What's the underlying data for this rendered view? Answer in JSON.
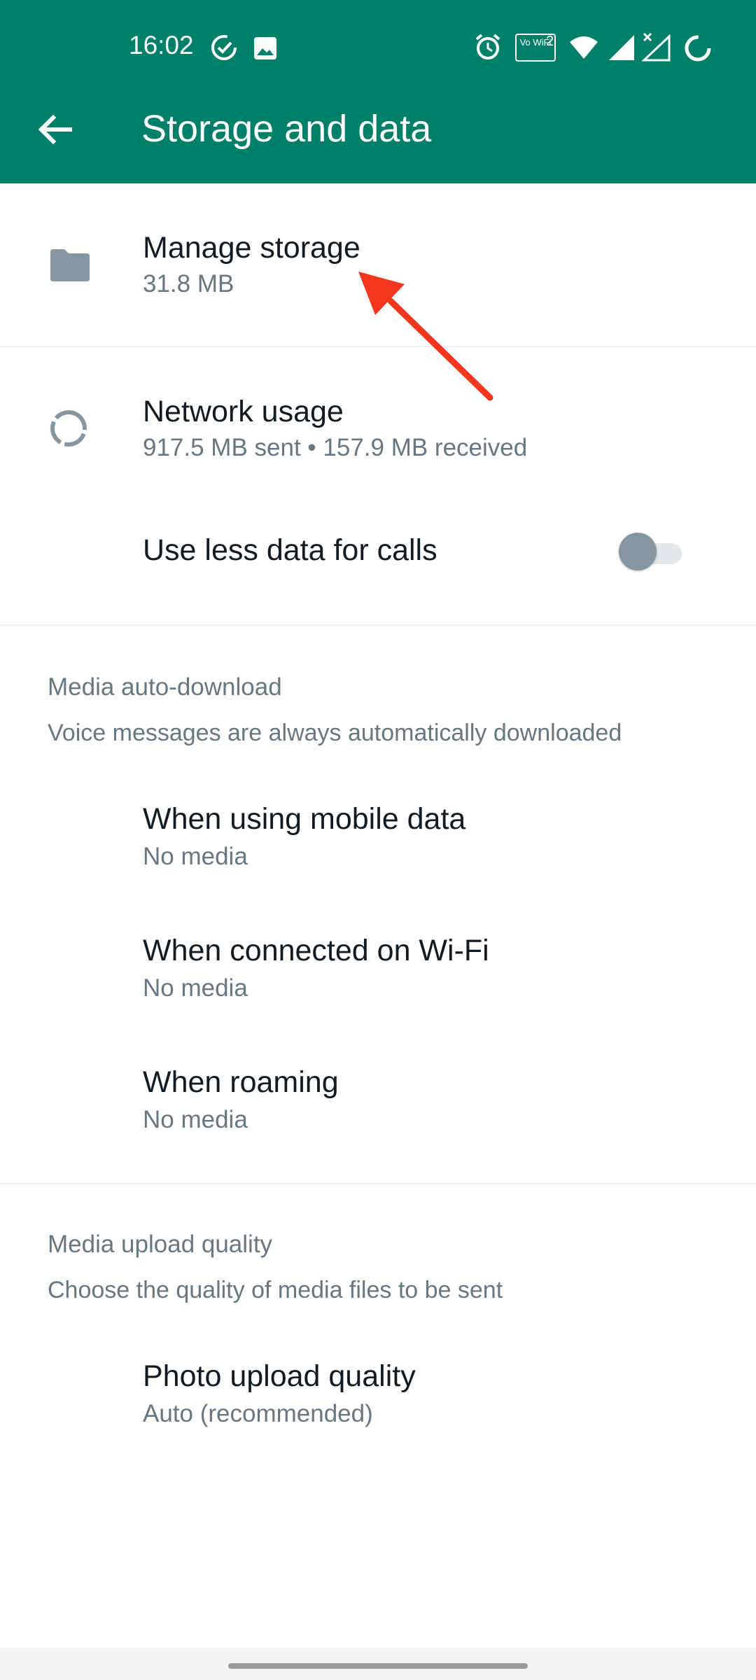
{
  "status_bar": {
    "time": "16:02",
    "icons": [
      "check-circle-icon",
      "image-icon",
      "alarm-icon",
      "vowifi-icon",
      "wifi-icon",
      "signal-icon",
      "signal-no-data-icon",
      "loading-ring-icon"
    ],
    "vowifi_text": "Vo WiFi",
    "vowifi_sub": "2"
  },
  "appbar": {
    "title": "Storage and data",
    "back_icon": "arrow-left-icon",
    "color": "#008069"
  },
  "items": {
    "manage_storage": {
      "title": "Manage storage",
      "subtitle": "31.8 MB",
      "icon": "folder-icon"
    },
    "network_usage": {
      "title": "Network usage",
      "subtitle": "917.5 MB sent • 157.9 MB received",
      "icon": "data-usage-icon"
    },
    "less_data_calls": {
      "title": "Use less data for calls",
      "enabled": false
    }
  },
  "media_auto_download": {
    "header": "Media auto-download",
    "description": "Voice messages are always automatically downloaded",
    "options": [
      {
        "title": "When using mobile data",
        "value": "No media"
      },
      {
        "title": "When connected on Wi-Fi",
        "value": "No media"
      },
      {
        "title": "When roaming",
        "value": "No media"
      }
    ]
  },
  "media_upload_quality": {
    "header": "Media upload quality",
    "description": "Choose the quality of media files to be sent",
    "photo_quality": {
      "title": "Photo upload quality",
      "value": "Auto (recommended)"
    }
  },
  "annotation": {
    "color": "#f4361f"
  }
}
